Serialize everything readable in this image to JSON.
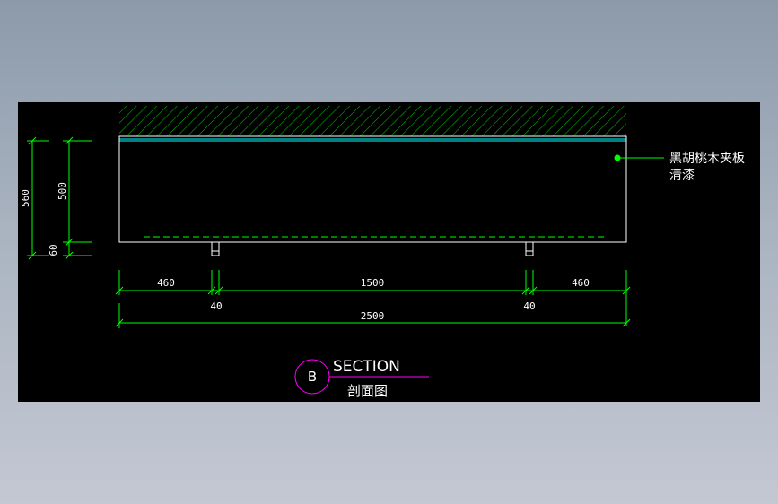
{
  "drawing": {
    "dimensions": {
      "overall_height": "560",
      "panel_height": "500",
      "base_height": "60",
      "left_span": "460",
      "left_gap": "40",
      "middle_span": "1500",
      "right_gap": "40",
      "right_span": "460",
      "total_width": "2500"
    },
    "material_label": {
      "line1": "黑胡桃木夹板",
      "line2": "清漆"
    },
    "section_title": {
      "marker": "B",
      "title": "SECTION",
      "subtitle": "剖面图"
    }
  },
  "colors": {
    "background_dark": "#000000",
    "dimension": "#00ff00",
    "outline": "#ffffff",
    "hatch": "#00c000",
    "cyan_line": "#00ffff",
    "yellow_line": "#ffff00",
    "marker_circle": "#ff00ff"
  }
}
